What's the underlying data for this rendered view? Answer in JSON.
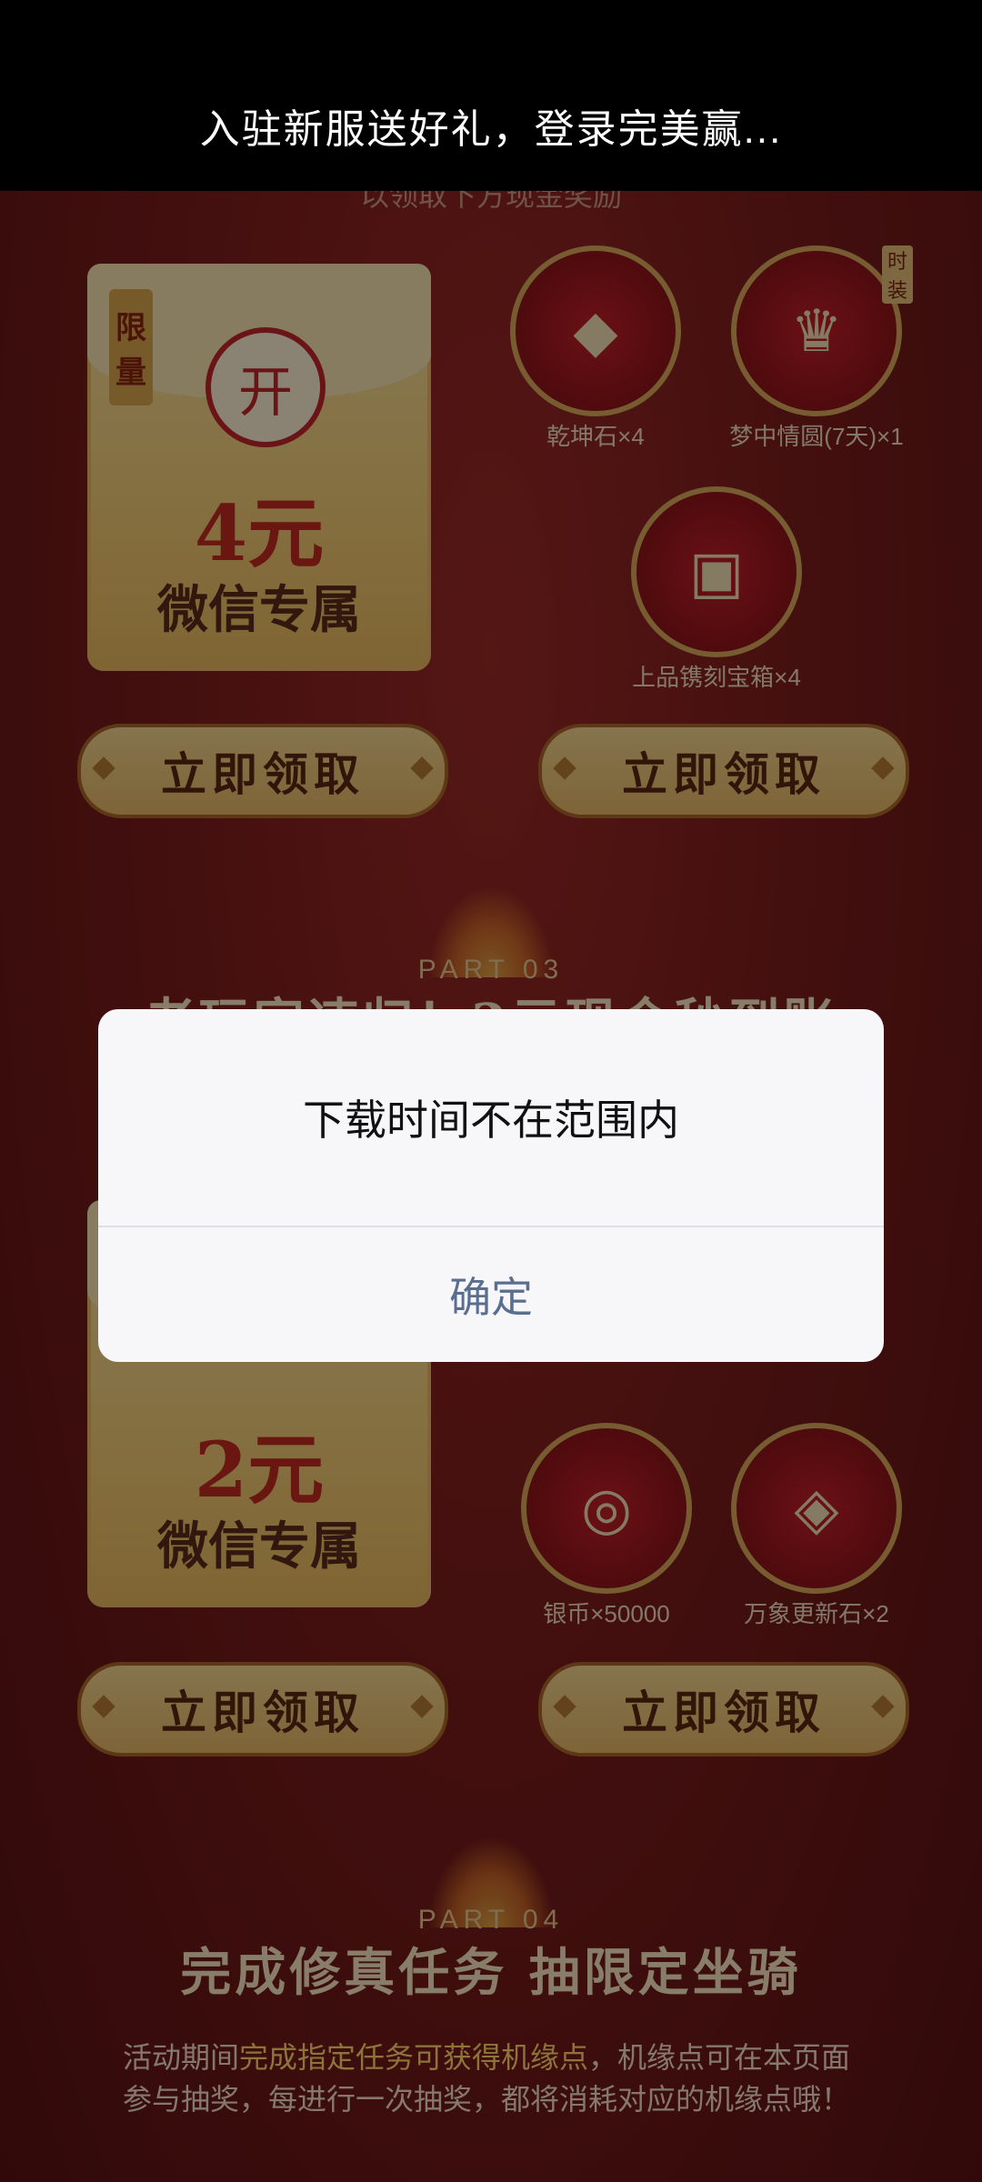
{
  "window": {
    "title": "入驻新服送好礼，登录完美赢..."
  },
  "top_subline": "以领取下方现金奖励",
  "section1": {
    "envelope": {
      "tag_chars": [
        "限",
        "量"
      ],
      "seal": "开",
      "amount": "4元",
      "desc": "微信专属"
    },
    "items": [
      {
        "label": "乾坤石×4",
        "icon": "green-gem-icon"
      },
      {
        "label": "梦中情圆(7天)×1",
        "icon": "costume-icon",
        "badge": [
          "时",
          "装"
        ]
      },
      {
        "label": "上品镌刻宝箱×4",
        "icon": "treasure-chest-icon"
      }
    ],
    "buttons": [
      "立即领取",
      "立即领取"
    ]
  },
  "part03": {
    "label": "PART 03",
    "title": "老玩家速归！2元现金秒到账"
  },
  "section2": {
    "envelope": {
      "amount": "2元",
      "desc": "微信专属"
    },
    "items": [
      {
        "label": "银币×50000",
        "icon": "silver-coin-icon"
      },
      {
        "label": "万象更新石×2",
        "icon": "amber-stone-icon"
      }
    ],
    "buttons": [
      "立即领取",
      "立即领取"
    ]
  },
  "part04": {
    "label": "PART 04",
    "title": "完成修真任务 抽限定坐骑",
    "desc_prefix": "活动期间",
    "desc_highlight": "完成指定任务可获得机缘点",
    "desc_suffix": "，机缘点可在本页面参与抽奖，每进行一次抽奖，都将消耗对应的机缘点哦！"
  },
  "dialog": {
    "message": "下载时间不在范围内",
    "confirm": "确定"
  }
}
